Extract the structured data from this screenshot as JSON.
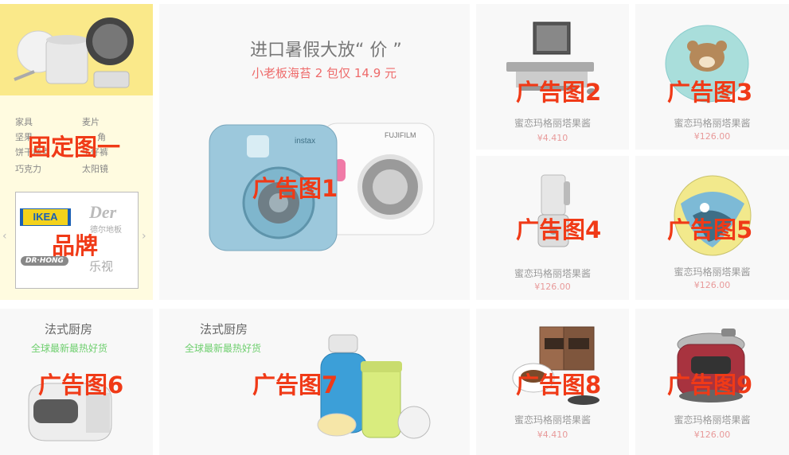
{
  "fixed_panel": {
    "label": "固定图一",
    "categories": [
      "家具",
      "麦片",
      "坚果",
      "饼干糕点",
      "巧克力",
      "太阳镜"
    ],
    "categories_partial": [
      "角",
      "牛仔裤"
    ],
    "brand_label": "品牌",
    "brands": [
      "IKEA",
      "Der",
      "德尔地板",
      "DR·HONG",
      "乐视"
    ],
    "prev_arrow": "‹",
    "next_arrow": "›"
  },
  "main_banner": {
    "title": "进口暑假大放“ 价 ”",
    "subtitle": "小老板海苔 2 包仅 14.9 元",
    "label": "广告图1",
    "camera_text_1": "instax",
    "camera_text_2": "FUJIFILM"
  },
  "products": [
    {
      "label": "广告图2",
      "name": "蜜恋玛格丽塔果酱",
      "price": "¥4.410",
      "icon": "computer-icon"
    },
    {
      "label": "广告图3",
      "name": "蜜恋玛格丽塔果酱",
      "price": "¥126.00",
      "icon": "bear-tray-icon"
    },
    {
      "label": "广告图4",
      "name": "蜜恋玛格丽塔果酱",
      "price": "¥126.00",
      "icon": "juicer-icon"
    },
    {
      "label": "广告图5",
      "name": "蜜恋玛格丽塔果酱",
      "price": "¥126.00",
      "icon": "round-box-icon"
    },
    {
      "label": "广告图8",
      "name": "蜜恋玛格丽塔果酱",
      "price": "¥4.410",
      "icon": "coffee-bag-icon"
    },
    {
      "label": "广告图9",
      "name": "蜜恋玛格丽塔果酱",
      "price": "¥126.00",
      "icon": "rice-cooker-icon"
    }
  ],
  "feature_cards": [
    {
      "title": "法式厨房",
      "subtitle": "全球最新最热好货",
      "label": "广告图6",
      "icon": "vr-headset-icon"
    },
    {
      "title": "法式厨房",
      "subtitle": "全球最新最热好货",
      "label": "广告图7",
      "icon": "thermos-icon"
    }
  ],
  "colors": {
    "label_red": "#f03a17",
    "price_red": "#e89a9a",
    "green": "#6fcf6f",
    "yellow_panel": "#fffbe0"
  }
}
